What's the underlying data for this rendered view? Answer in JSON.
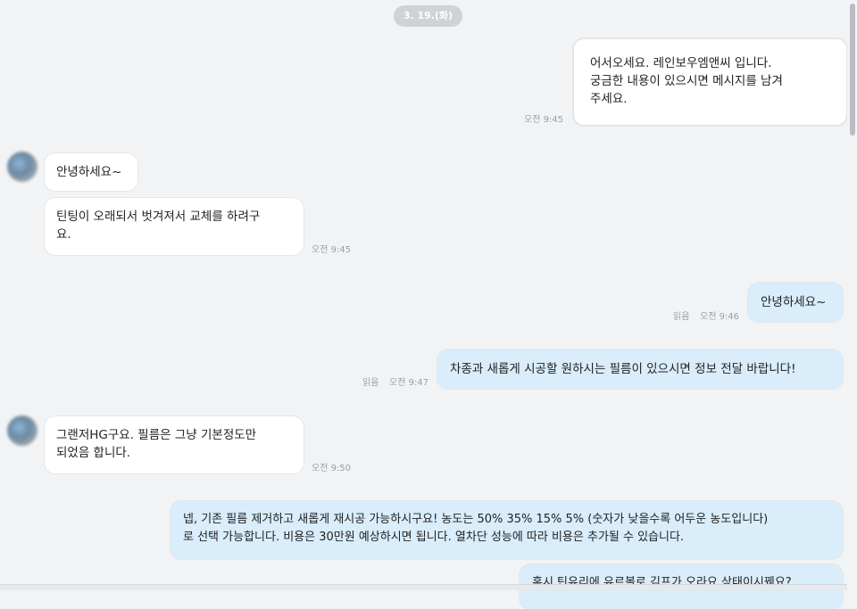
{
  "date_label": "3. 19.(화)",
  "messages": [
    {
      "text": "어서오세요. 레인보우엠앤씨 입니다.\n궁금한 내용이 있으시면 메시지를 남겨\n주세요.",
      "time": "오전 9:45"
    },
    {
      "text": "안녕하세요~"
    },
    {
      "text": "틴팅이 오래되서 벗겨져서 교체를 하려구\n요.",
      "time": "오전 9:45"
    },
    {
      "text": "안녕하세요~",
      "read": "읽음",
      "time": "오전 9:46"
    },
    {
      "text": "차종과 새롭게 시공할 원하시는 필름이 있으시면 정보 전달 바랍니다!",
      "read": "읽음",
      "time": "오전 9:47"
    },
    {
      "text": "그랜저HG구요. 필름은 그냥 기본정도만\n되었음 합니다.",
      "time": "오전 9:50"
    },
    {
      "text": "넵, 기존 필름 제거하고 새롭게 재시공 가능하시구요! 농도는 50% 35% 15% 5% (숫자가 낮을수록 어두운 농도입니다)\n로 선택 가능합니다. 비용은 30만원 예상하시면 됩니다. 열차단 성능에 따라 비용은 추가될 수 있습니다."
    },
    {
      "text": "혹시 틴유리에 유르볼로 김프가 오라요 상태이시꿰요?"
    }
  ]
}
